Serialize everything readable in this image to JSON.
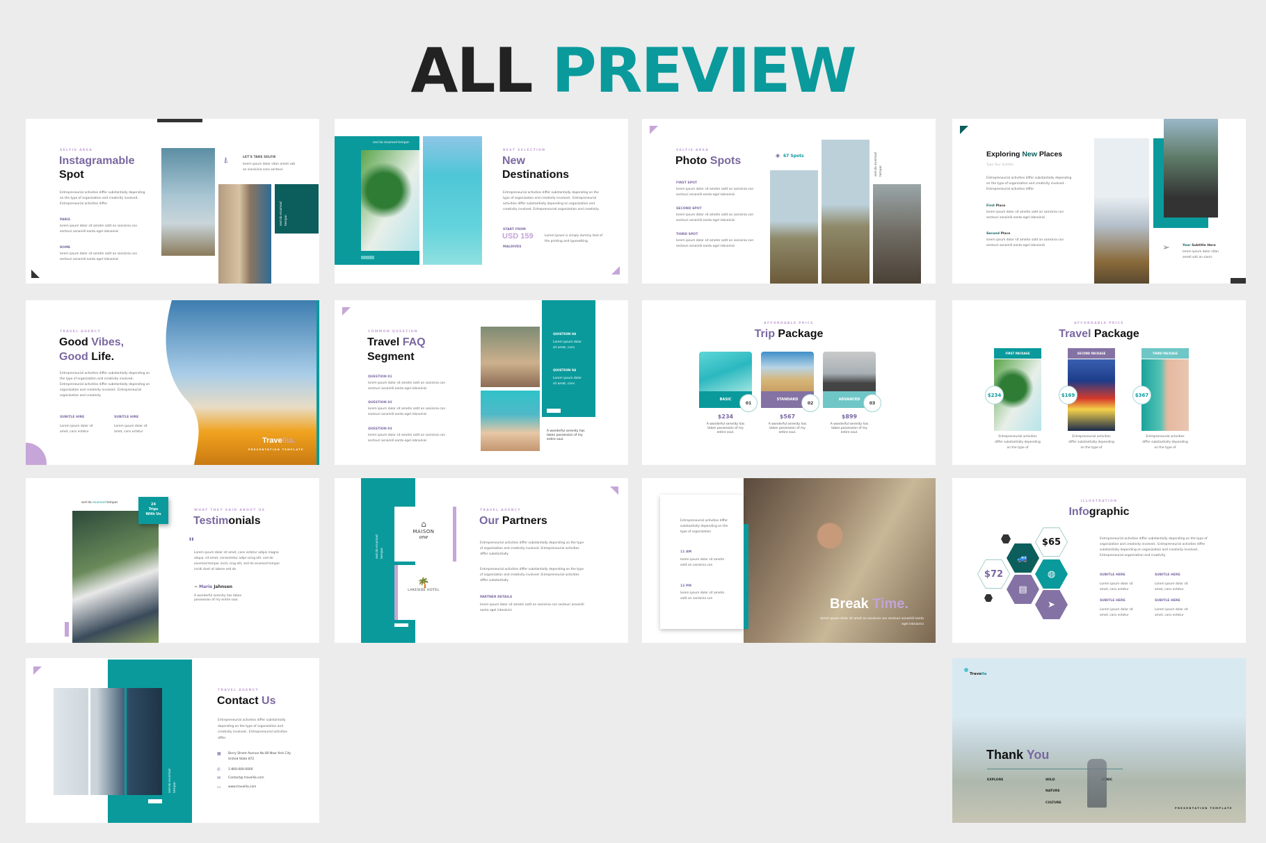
{
  "header": {
    "title_dark": "ALL",
    "title_accent": "PREVIEW"
  },
  "colors": {
    "teal": "#0a9a9c",
    "dark_teal": "#0b5e5c",
    "purple": "#7a67a0",
    "light_purple": "#c6a6d8",
    "background": "#ececec"
  },
  "common": {
    "lorem_2line": "lorem ipsum dolor sit ametin satit an sanisinia con secteuri asnainlil eanta egel inbnainisi",
    "entre_short": "Entrepreneurial activities differ substantially depending on the type of organization and creativity involved.. Entrepreneurial activities differ",
    "entre_long": "Entrepreneurial activities differ substantially depending on the type of organization and creativity involved.. Entrepreneurial activities differ substantially depending on organization and creativity involved.. Entrepreneurial organization and creativity",
    "sed": "sed do eiusmod tempor.",
    "serenity": "A wonderful serenity has taken possession of my entire soul.",
    "subtitle": "SUBITLE HERE",
    "lorem_amet": "Lorem ipsum dolor sit amet, cons ectetur"
  },
  "slides": {
    "s1": {
      "label": "SELFIE AREA",
      "title_a": "Instagramable",
      "title_b": "Spot",
      "h1": "PARIS",
      "h2": "ROME",
      "side_head": "LET'S TAKE SELFIE",
      "side_text": "lorem ipsum dolor sitan ameti sati an sianisinia cons secteun",
      "icon": "eiffel-tower-icon"
    },
    "s2": {
      "label": "BEST SELECTION",
      "title_a": "New",
      "title_b": "Destinations",
      "start": "START FROM",
      "price": "USD 159",
      "place": "MALDIVES",
      "side_text": "Lorem Ipsum is simply dummy text of the printing and typesetting",
      "body": "Entrepreneurial activities differ substantially depending on the type of organization and creativity involved.. Entrepreneurial activities differ substantially depending on organization and creativity involved. Entrepreneurial organization and creativity"
    },
    "s3": {
      "label": "SELFIE AREA",
      "title_a": "Photo",
      "title_b": "Spots",
      "count": "67 Spots",
      "h1": "FIRST SPOT",
      "h2": "SECOND SPOT",
      "h3": "THIRD SPOT"
    },
    "s4": {
      "title_a": "Exploring",
      "title_b": "New",
      "title_c": "Places",
      "subtitle": "Type Your Subtitle",
      "h1a": "First",
      "h1b": "Place",
      "h2a": "Second",
      "h2b": "Place",
      "side_a": "Your",
      "side_b": "Subtitle Here",
      "side_text": "lorem ipsum dolor sitan ameti sati an sianis"
    },
    "s5": {
      "label": "TRAVEL AGENCY",
      "l1a": "Good",
      "l1b": "Vibes,",
      "l2a": "Good",
      "l2b": "Life.",
      "brand_a": "Trave",
      "brand_b": "llia.",
      "brand_sub": "PRESENTATION TEMPLATE",
      "sub": "SUBITLE HIRE",
      "sub_text": "Lorem ipsum dolor sit amet, cons ectetur"
    },
    "s6": {
      "label": "COMMON QUESTION",
      "title_a": "Travel",
      "title_b": "FAQ",
      "title_c": "Segment",
      "q1": "QUESTION 01",
      "q2": "QUESTION 02",
      "q3": "QUESTION 03",
      "q4": "QUISTION 04",
      "q4_text": "Lorem ipsum dolor sit amet, cons"
    },
    "s7": {
      "label": "AFFORDABLE PRICE",
      "title_a": "Trip",
      "title_b": "Package",
      "cards": [
        {
          "name": "BASIC",
          "num": "01",
          "price": "$234"
        },
        {
          "name": "STANDARD",
          "num": "02",
          "price": "$567"
        },
        {
          "name": "ADVANCED",
          "num": "03",
          "price": "$899"
        }
      ]
    },
    "s8": {
      "label": "AFFORDABLE PRICE",
      "title_a": "Travel",
      "title_b": "Package",
      "text": "Entrepreneurial activities differ substantially depending on the type of",
      "cols": [
        {
          "name": "FIRST PACKAGE",
          "price": "$234"
        },
        {
          "name": "SECOND PACKAGE",
          "price": "$169"
        },
        {
          "name": "THIRD PACKAGE",
          "price": "$367"
        }
      ]
    },
    "s9": {
      "sed_a": "sed do",
      "sed_b": "eiusmod",
      "sed_c": "tempor.",
      "badge_num": "24",
      "badge_a": "Trips",
      "badge_b": "With Us",
      "label": "WHAT THEY SAID ABOUT US",
      "title_a": "Testim",
      "title_b": "onials",
      "quote": "Lorem ipsum dolor sit amet, cons ectetur adipis magna aliqua. sit amet, consectetur adipi scing elit. sed do eiusmod tempor incid, cing elit, sed do eiusmod tempor incidi dunt ut labore sed do",
      "author_a": "Marie",
      "author_b": "Jahnsen"
    },
    "s10": {
      "label": "TRAVEL AGENCY",
      "title_a": "Our",
      "title_b": "Partners",
      "logo1_a": "MAISON",
      "logo1_b": "one",
      "logo2": "LAKESIDE HOTEL",
      "details": "PARTNER DETAILS",
      "para": "Entrepreneurial activities differ substantially depending on the type of organization and creativity involved. Entrepreneurial activities differ substantially",
      "details_text": "lorem ipsum dolor sit ametin satit an sanisinia con secteuri asnainlil eanta egel inbnainisi"
    },
    "s11": {
      "intro": "Entrepreneurial activities differ substantially depending on the type of organization",
      "t1": "11 AM",
      "t2": "12 PM",
      "t_text": "lorem ipsum dolor sit ametin satit an sanisinia con",
      "title_a": "Break",
      "title_b": "Time.",
      "sub": "lorem ipsum dolor sit amet an sanisinia con secteuri asnainlil eanta egel inbnainisi"
    },
    "s12": {
      "label": "ILLUSTRATION",
      "title_a": "Info",
      "title_b": "graphic",
      "v1": "$65",
      "v2": "$72",
      "icons": [
        "car-icon",
        "globe-icon",
        "luggage-icon",
        "paper-plane-icon"
      ],
      "body": "Entrepreneurial activities differ substantially depending on the type of organization and creativity involved.. Entrepreneurial activities differ substantially depending on organization and creativity involved.. Entrepreneurial organization and creativity"
    },
    "s13": {
      "label": "TRAVEL AGENCY",
      "title_a": "Contact",
      "title_b": "Us",
      "body": "Entrepreneurial activities differ substantially depending on the type of organization and creativity involved.. Entrepreneurial activities differ",
      "address": "Berry Street Avenue No 80 New York City United State 872",
      "phone": "1-800-000-0000",
      "email": "Contact@ travellia.com",
      "web": "www.travellia.com"
    },
    "s14": {
      "brand_a": "Trave",
      "brand_b": "lla",
      "title_a": "Thank",
      "title_b": "You",
      "w1": "EXPLORE",
      "w2": "WILD",
      "w3": "NATURE",
      "w4": "CULTURE",
      "w5": "ETNIC",
      "footer": "PRESENTATION TEMPLATE"
    }
  }
}
